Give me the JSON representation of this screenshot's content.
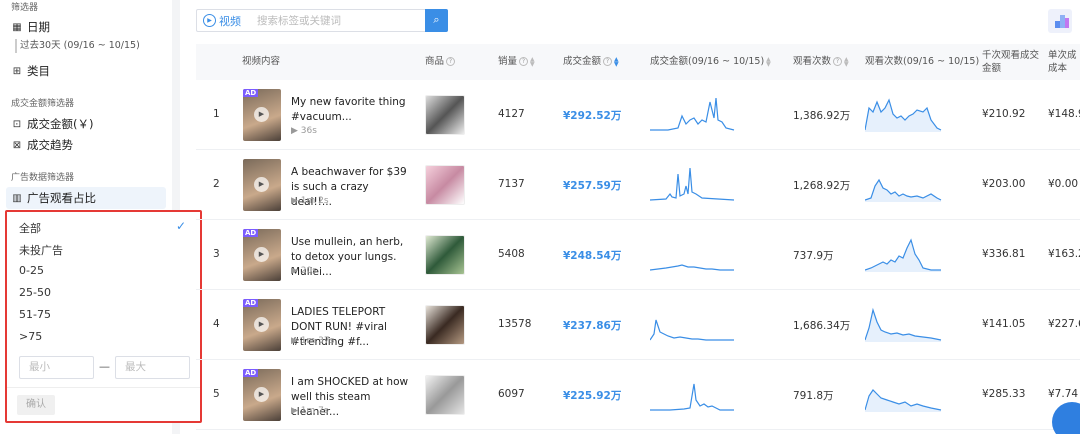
{
  "sidebar": {
    "filter_title": "筛选器",
    "date_label": "日期",
    "date_range": "过去30天 (09/16 ~ 10/15)",
    "category_label": "类目",
    "gmv_filter_title": "成交金额筛选器",
    "gmv_label": "成交金额(￥)",
    "gmv_trend_label": "成交趋势",
    "ad_filter_title": "广告数据筛选器",
    "ad_ratio_label": "广告观看占比"
  },
  "dropdown": {
    "options": [
      "全部",
      "未投广告",
      "0-25",
      "25-50",
      "51-75",
      ">75"
    ],
    "selected": "全部",
    "min_placeholder": "最小",
    "max_placeholder": "最大",
    "dash": "—",
    "confirm_label": "确认"
  },
  "toolbar": {
    "video_label": "视频",
    "search_placeholder": "搜索标签或关键词"
  },
  "table": {
    "headers": {
      "video": "视频内容",
      "product": "商品",
      "sales": "销量",
      "gmv": "成交金额",
      "gmv_trend": "成交金额(09/16 ~ 10/15)",
      "views": "观看次数",
      "views_trend": "观看次数(09/16 ~ 10/15)",
      "cpm_line1": "千次观看成交",
      "cpm_line2": "金额",
      "cpc_line1": "单次成",
      "cpc_line2": "成本"
    },
    "rows": [
      {
        "rank": "1",
        "ad": "AD",
        "title": "My new favorite thing #vacuum...",
        "duration": "▶ 36s",
        "sales": "4127",
        "gmv": "¥292.52万",
        "views": "1,386.92万",
        "cpm": "¥210.92",
        "cpc": "¥148.9"
      },
      {
        "rank": "2",
        "ad": "",
        "title": "A beachwaver for $39 is such a crazy deal!!...",
        "duration": "▶ 1m 2s",
        "sales": "7137",
        "gmv": "¥257.59万",
        "views": "1,268.92万",
        "cpm": "¥203.00",
        "cpc": "¥0.00"
      },
      {
        "rank": "3",
        "ad": "AD",
        "title": "Use mullein, an herb, to detox your lungs. Mullei...",
        "duration": "▶ 20s",
        "sales": "5408",
        "gmv": "¥248.54万",
        "views": "737.9万",
        "cpm": "¥336.81",
        "cpc": "¥163.2"
      },
      {
        "rank": "4",
        "ad": "AD",
        "title": "LADIES TELEPORT DONT RUN! #viral #trending #f...",
        "duration": "▶ 1m 37s",
        "sales": "13578",
        "gmv": "¥237.86万",
        "views": "1,686.34万",
        "cpm": "¥141.05",
        "cpc": "¥227.6"
      },
      {
        "rank": "5",
        "ad": "AD",
        "title": "I am SHOCKED at how well this steam cleaner...",
        "duration": "▶ 1m 7s",
        "sales": "6097",
        "gmv": "¥225.92万",
        "views": "791.8万",
        "cpm": "¥285.33",
        "cpc": "¥7.74"
      }
    ]
  }
}
